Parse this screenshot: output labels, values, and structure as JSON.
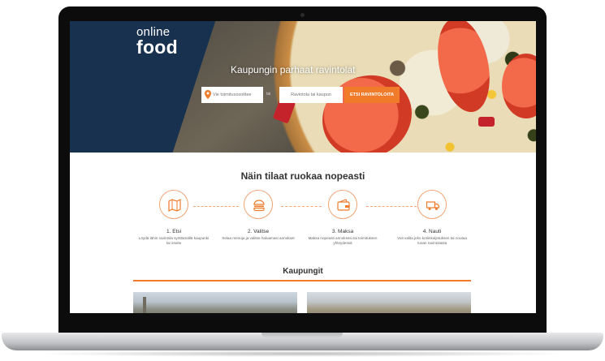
{
  "hero": {
    "logo_line1": "online",
    "logo_line2": "food",
    "title": "Kaupungin parhaat ravintolat",
    "address_placeholder": "Vie toimitusosoittee",
    "or_label": "tai",
    "restaurant_placeholder": "Ravintola tai kaupun",
    "search_button": "ETSI RAVINTOLOITA"
  },
  "how": {
    "title": "Näin tilaat ruokaa nopeasti",
    "steps": [
      {
        "title": "1. Etsi",
        "desc": "Löydä lähin ravintola syöttämällä kaupunki tai osoite",
        "icon": "map-icon"
      },
      {
        "title": "2. Valitse",
        "desc": "Selaa menuja ja valitse haluamasi annokset",
        "icon": "burger-icon"
      },
      {
        "title": "3. Maksa",
        "desc": "Maksa nopeasti annoksesi tai toimituksen yhteydessä",
        "icon": "wallet-icon"
      },
      {
        "title": "4. Nauti",
        "desc": "Voit valita joko kotiinkuljetuksen tai noutaa ruoan ravintolasta",
        "icon": "delivery-truck-icon"
      }
    ]
  },
  "cities": {
    "title": "Kaupungit"
  },
  "colors": {
    "accent": "#f07b2b",
    "hero_bg": "#17314f",
    "icon_ring": "#f3a574"
  }
}
